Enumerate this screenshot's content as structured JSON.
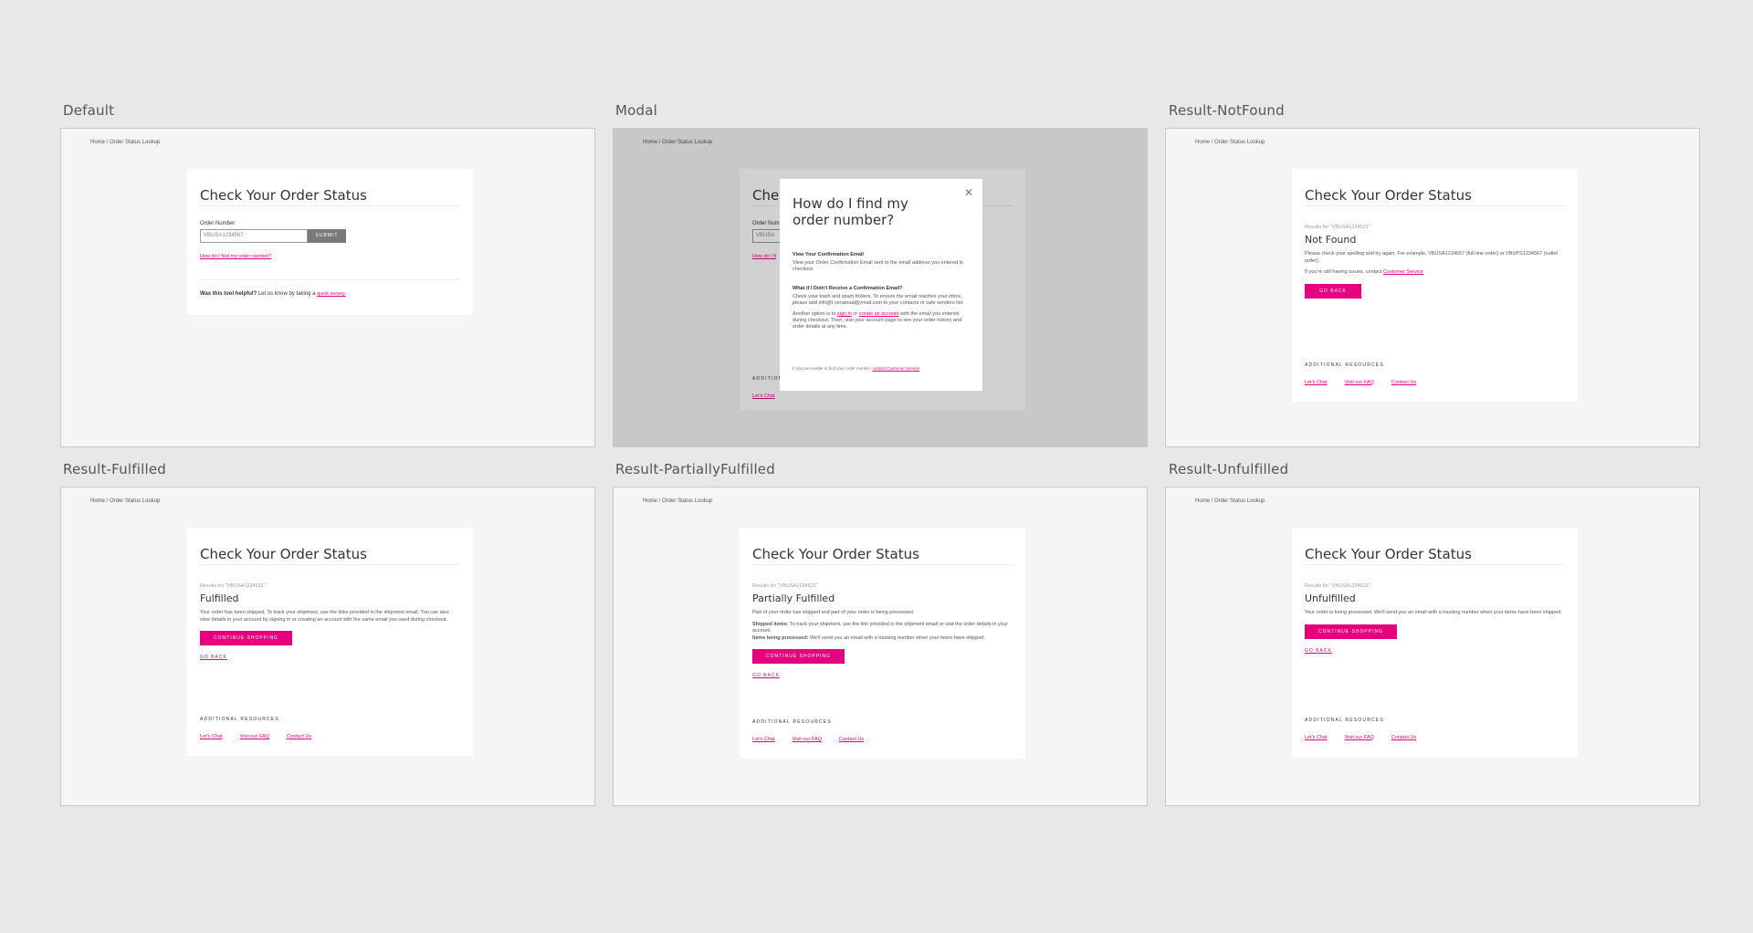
{
  "frames": {
    "default": {
      "label": "Default",
      "breadcrumb": "Home / Order Status Lookup",
      "title": "Check Your Order Status",
      "order_label": "Order Number",
      "order_placeholder": "VBUSA1234567",
      "submit": "SUBMIT",
      "find_link": "How do I find my order number?",
      "helpful_bold": "Was this tool helpful?",
      "helpful_text": " Let us know by taking a ",
      "helpful_link": "quick survey."
    },
    "modal": {
      "label": "Modal",
      "breadcrumb": "Home / Order Status Lookup",
      "bg_title": "Che",
      "bg_order_label": "Order Num",
      "bg_input": "VBUSA",
      "bg_link": "How do I fi",
      "bg_additional": "ADDITION",
      "bg_res_link": "Let's Chat",
      "title": "How do I find my order number?",
      "section1_title": "View Your Confirmation Email",
      "section1_text": "View your Order Confirmation Email sent to the email address you entered in checkout.",
      "section2_title": "What if I Didn't Receive a Confirmation Email?",
      "section2_text": "Check your trash and spam folders. To ensure the email reaches your inbox, please add info@t.verabrad@ymail.com to your contacts or safe senders list.",
      "section3_prefix": "Another option is to ",
      "section3_signin": "sign in",
      "section3_or": " or ",
      "section3_create": "create an account",
      "section3_suffix": " with the email you entered during checkout. Then, visit your account page to see your order history and order details at any time.",
      "footer_prefix": "If you are unable to find your order number, ",
      "footer_link": "contact Customer Service"
    },
    "notfound": {
      "label": "Result-NotFound",
      "breadcrumb": "Home / Order Status Lookup",
      "title": "Check Your Order Status",
      "results_for": "Results for \"VBUSA1234521\"",
      "heading": "Not Found",
      "text1": "Please check your spelling and try again. For example, VBUSA1234567 (full-line order) or VBUPS1234567 (outlet order).",
      "text2_prefix": "If you're still having issues, contact ",
      "text2_link": "Customer Service",
      "button": "GO BACK",
      "additional": "ADDITIONAL RESOURCES",
      "links": [
        "Let's Chat",
        "Visit our FAQ",
        "Contact Us"
      ]
    },
    "fulfilled": {
      "label": "Result-Fulfilled",
      "breadcrumb": "Home / Order Status Lookup",
      "title": "Check Your Order Status",
      "results_for": "Results for \"VBUSA1234521\"",
      "heading": "Fulfilled",
      "text": "Your order has been shipped. To track your shipment, use the links provided in the shipment email. You can also view details in your account by signing in or creating an account with the same email you used during checkout.",
      "button": "CONTINUE SHOPPING",
      "goback": "GO BACK",
      "additional": "ADDITIONAL RESOURCES",
      "links": [
        "Let's Chat",
        "Visit our FAQ",
        "Contact Us"
      ]
    },
    "partial": {
      "label": "Result-PartiallyFulfilled",
      "breadcrumb": "Home / Order Status Lookup",
      "title": "Check Your Order Status",
      "results_for": "Results for \"VBUSA1234521\"",
      "heading": "Partially Fulfilled",
      "text1": "Part of your order has shipped and part of your order is being processed.",
      "shipped_bold": "Shipped items:",
      "shipped_text": " To track your shipment, use the link provided in the shipment email or visit the order details in your account.",
      "processing_bold": "Items being processed:",
      "processing_text": " We'll send you an email with a tracking number when your items have shipped.",
      "button": "CONTINUE SHOPPING",
      "goback": "GO BACK",
      "additional": "ADDITIONAL RESOURCES",
      "links": [
        "Let's Chat",
        "Visit our FAQ",
        "Contact Us"
      ]
    },
    "unfulfilled": {
      "label": "Result-Unfulfilled",
      "breadcrumb": "Home / Order Status Lookup",
      "title": "Check Your Order Status",
      "results_for": "Results for \"VBUSA1234521\"",
      "heading": "Unfulfilled",
      "text": "Your order is being processed. We'll send you an email with a tracking number when your items have been shipped.",
      "button": "CONTINUE SHOPPING",
      "goback": "GO BACK",
      "additional": "ADDITIONAL RESOURCES",
      "links": [
        "Let's Chat",
        "Visit our FAQ",
        "Contact Us"
      ]
    }
  },
  "colors": {
    "accent": "#e6007e",
    "canvas": "#e8e8e8",
    "frame": "#f5f5f5"
  }
}
